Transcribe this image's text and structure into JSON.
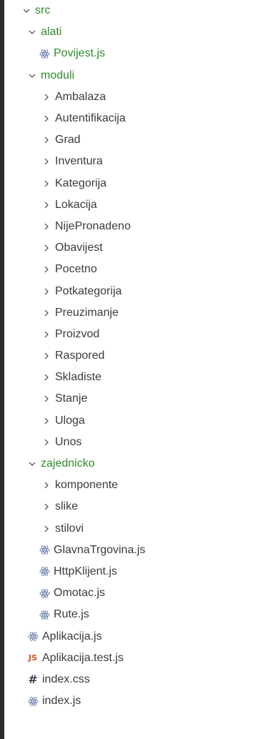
{
  "explorer": {
    "root": {
      "label": "src",
      "state": "expanded"
    },
    "alati": {
      "label": "alati",
      "state": "expanded",
      "files": [
        "Povijest.js"
      ]
    },
    "moduli": {
      "label": "moduli",
      "state": "expanded",
      "folders": [
        "Ambalaza",
        "Autentifikacija",
        "Grad",
        "Inventura",
        "Kategorija",
        "Lokacija",
        "NijePronadeno",
        "Obavijest",
        "Pocetno",
        "Potkategorija",
        "Preuzimanje",
        "Proizvod",
        "Raspored",
        "Skladiste",
        "Stanje",
        "Uloga",
        "Unos"
      ]
    },
    "zajednicko": {
      "label": "zajednicko",
      "state": "expanded",
      "folders": [
        "komponente",
        "slike",
        "stilovi"
      ],
      "files": [
        "GlavnaTrgovina.js",
        "HttpKlijent.js",
        "Omotac.js",
        "Rute.js"
      ]
    },
    "root_files": [
      {
        "label": "Aplikacija.js",
        "icon": "react-icon"
      },
      {
        "label": "Aplikacija.test.js",
        "icon": "js-icon",
        "badge": "JS"
      },
      {
        "label": "index.css",
        "icon": "css-hash-icon",
        "badge": "#"
      },
      {
        "label": "index.js",
        "icon": "react-icon"
      }
    ],
    "colors": {
      "folder_label_green": "#2e8b2e",
      "text": "#3b3b3b",
      "react_icon": "#6a7fae",
      "js_badge": "#d1541f",
      "sidebar_dark": "#2b2b2b"
    }
  }
}
